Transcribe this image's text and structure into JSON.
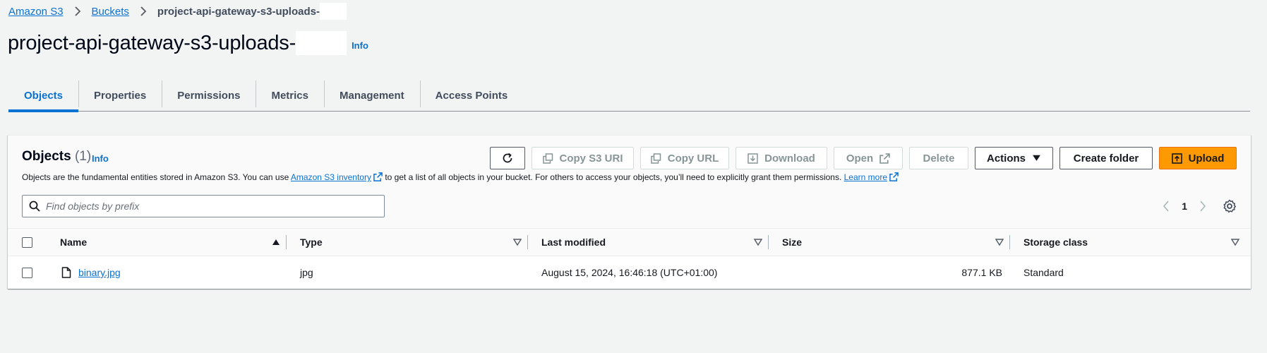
{
  "breadcrumbs": {
    "items": [
      {
        "label": "Amazon S3"
      },
      {
        "label": "Buckets"
      }
    ],
    "current": "project-api-gateway-s3-uploads-"
  },
  "page": {
    "title": "project-api-gateway-s3-uploads-",
    "info": "Info"
  },
  "tabs": [
    {
      "label": "Objects",
      "active": true
    },
    {
      "label": "Properties"
    },
    {
      "label": "Permissions"
    },
    {
      "label": "Metrics"
    },
    {
      "label": "Management"
    },
    {
      "label": "Access Points"
    }
  ],
  "objects": {
    "title": "Objects",
    "count": "(1)",
    "info": "Info",
    "description_pre": "Objects are the fundamental entities stored in Amazon S3. You can use ",
    "description_link1": "Amazon S3 inventory",
    "description_mid": " to get a list of all objects in your bucket. For others to access your objects, you’ll need to explicitly grant them permissions. ",
    "description_link2": "Learn more"
  },
  "toolbar": {
    "copy_s3_uri": "Copy S3 URI",
    "copy_url": "Copy URL",
    "download": "Download",
    "open": "Open",
    "delete": "Delete",
    "actions": "Actions",
    "create_folder": "Create folder",
    "upload": "Upload"
  },
  "search": {
    "placeholder": "Find objects by prefix"
  },
  "pagination": {
    "current_page": "1"
  },
  "table": {
    "columns": [
      "Name",
      "Type",
      "Last modified",
      "Size",
      "Storage class"
    ],
    "rows": [
      {
        "name": "binary.jpg",
        "type": "jpg",
        "last_modified": "August 15, 2024, 16:46:18 (UTC+01:00)",
        "size": "877.1 KB",
        "storage_class": "Standard"
      }
    ]
  },
  "colors": {
    "link": "#0972d3",
    "primary_button": "#ff9900",
    "background": "#f2f3f3"
  }
}
